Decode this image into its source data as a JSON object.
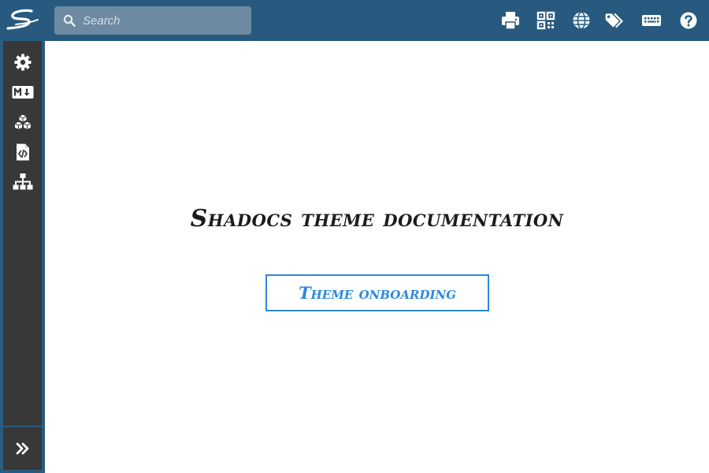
{
  "header": {
    "logo_icon": "shadocs-logo-icon",
    "search": {
      "placeholder": "Search",
      "value": "",
      "icon": "search-icon"
    },
    "actions": [
      {
        "name": "print",
        "icon": "print-icon"
      },
      {
        "name": "qrcode",
        "icon": "qrcode-icon"
      },
      {
        "name": "language",
        "icon": "globe-icon"
      },
      {
        "name": "tags",
        "icon": "tags-icon"
      },
      {
        "name": "keyboard-shortcuts",
        "icon": "keyboard-icon"
      },
      {
        "name": "help",
        "icon": "question-circle-icon"
      }
    ]
  },
  "sidebar": {
    "items": [
      {
        "name": "settings",
        "icon": "gear-icon"
      },
      {
        "name": "markdown",
        "icon": "markdown-icon"
      },
      {
        "name": "components",
        "icon": "cubes-icon"
      },
      {
        "name": "code-file",
        "icon": "file-code-icon"
      },
      {
        "name": "sitemap",
        "icon": "sitemap-icon"
      }
    ],
    "toggle_icon": "angle-double-right-icon"
  },
  "main": {
    "title": "Shadocs theme documentation",
    "button_label": "Theme onboarding"
  },
  "colors": {
    "topbar": "#275a7e",
    "search_bg": "#6d8aa2",
    "sidebar_bg": "#383838",
    "accent": "#2b88e0",
    "title_text": "#1c1c1c"
  }
}
